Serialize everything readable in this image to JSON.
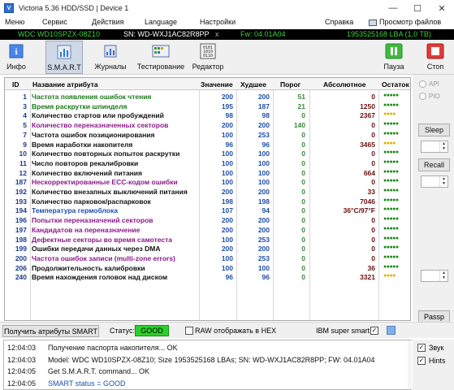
{
  "window": {
    "title": "Victoria 5.36 HDD/SSD | Device 1",
    "app_icon": "V"
  },
  "menu": {
    "items": [
      "Меню",
      "Сервис",
      "Действия",
      "Language",
      "Настройки",
      "Справка"
    ],
    "browser": "Просмотр файлов"
  },
  "device": {
    "model": "WDC WD10SPZX-08Z10",
    "sn": "SN: WD-WXJ1AC82R8PP",
    "close": "x",
    "fw": "Fw: 04.01A04",
    "capacity": "1953525168 LBA (1,0 TB)"
  },
  "toolbar": {
    "info": "Инфо",
    "smart": "S.M.A.R.T",
    "journals": "Журналы",
    "testing": "Тестирование",
    "editor": "Редактор",
    "pause": "Пауза",
    "stop": "Стоп"
  },
  "table": {
    "columns": {
      "id": "ID",
      "name": "Название атрибута",
      "value": "Значение",
      "worst": "Худшее",
      "threshold": "Порог",
      "raw": "Абсолютное",
      "status": "Остаток"
    },
    "rows": [
      {
        "id": "1",
        "name": "Частота появления ошибок чтения",
        "value": "200",
        "worst": "200",
        "threshold": "51",
        "raw": "0",
        "status": "●●●●●",
        "name_color": "#1a7a1a",
        "status_color": "#1a8a1a"
      },
      {
        "id": "3",
        "name": "Время раскрутки шпинделя",
        "value": "195",
        "worst": "187",
        "threshold": "21",
        "raw": "1250",
        "status": "●●●●●",
        "name_color": "#1a7a1a",
        "status_color": "#1a8a1a"
      },
      {
        "id": "4",
        "name": "Количество стартов или пробуждений",
        "value": "98",
        "worst": "98",
        "threshold": "0",
        "raw": "2367",
        "status": "●●●●",
        "name_color": "#111111",
        "status_color": "#e0b000"
      },
      {
        "id": "5",
        "name": "Количество переназначенных секторов",
        "value": "200",
        "worst": "200",
        "threshold": "140",
        "raw": "0",
        "status": "●●●●●",
        "name_color": "#8a1a8a",
        "status_color": "#1a8a1a"
      },
      {
        "id": "7",
        "name": "Частота ошибок позиционирования",
        "value": "100",
        "worst": "253",
        "threshold": "0",
        "raw": "0",
        "status": "●●●●●",
        "name_color": "#111111",
        "status_color": "#1a8a1a"
      },
      {
        "id": "9",
        "name": "Время наработки накопителя",
        "value": "96",
        "worst": "96",
        "threshold": "0",
        "raw": "3465",
        "status": "●●●●",
        "name_color": "#111111",
        "status_color": "#e0b000"
      },
      {
        "id": "10",
        "name": "Количество повторных попыток раскрутки",
        "value": "100",
        "worst": "100",
        "threshold": "0",
        "raw": "0",
        "status": "●●●●●",
        "name_color": "#111111",
        "status_color": "#1a8a1a"
      },
      {
        "id": "11",
        "name": "Число повторов рекалибровки",
        "value": "100",
        "worst": "100",
        "threshold": "0",
        "raw": "0",
        "status": "●●●●●",
        "name_color": "#111111",
        "status_color": "#1a8a1a"
      },
      {
        "id": "12",
        "name": "Количество включений питания",
        "value": "100",
        "worst": "100",
        "threshold": "0",
        "raw": "664",
        "status": "●●●●●",
        "name_color": "#111111",
        "status_color": "#1a8a1a"
      },
      {
        "id": "187",
        "name": "Нескорректированные ECC-кодом ошибки",
        "value": "100",
        "worst": "100",
        "threshold": "0",
        "raw": "0",
        "status": "●●●●●",
        "name_color": "#8a1a8a",
        "status_color": "#1a8a1a"
      },
      {
        "id": "192",
        "name": "Количество внезапных выключений питания",
        "value": "200",
        "worst": "200",
        "threshold": "0",
        "raw": "33",
        "status": "●●●●●",
        "name_color": "#111111",
        "status_color": "#1a8a1a"
      },
      {
        "id": "193",
        "name": "Количество парковок/распарковок",
        "value": "198",
        "worst": "198",
        "threshold": "0",
        "raw": "7046",
        "status": "●●●●●",
        "name_color": "#111111",
        "status_color": "#1a8a1a"
      },
      {
        "id": "194",
        "name": "Температура гермоблока",
        "value": "107",
        "worst": "94",
        "threshold": "0",
        "raw": "36°C/97°F",
        "status": "●●●●●",
        "name_color": "#1a4fb0",
        "status_color": "#1a8a1a"
      },
      {
        "id": "196",
        "name": "Попытки переназначений секторов",
        "value": "200",
        "worst": "200",
        "threshold": "0",
        "raw": "0",
        "status": "●●●●●",
        "name_color": "#8a1a8a",
        "status_color": "#1a8a1a"
      },
      {
        "id": "197",
        "name": "Кандидатов на переназначение",
        "value": "200",
        "worst": "200",
        "threshold": "0",
        "raw": "0",
        "status": "●●●●●",
        "name_color": "#8a1a8a",
        "status_color": "#1a8a1a"
      },
      {
        "id": "198",
        "name": "Дефектные секторы во время самотеста",
        "value": "100",
        "worst": "253",
        "threshold": "0",
        "raw": "0",
        "status": "●●●●●",
        "name_color": "#8a1a8a",
        "status_color": "#1a8a1a"
      },
      {
        "id": "199",
        "name": "Ошибки передачи данных через DMA",
        "value": "200",
        "worst": "200",
        "threshold": "0",
        "raw": "0",
        "status": "●●●●●",
        "name_color": "#111111",
        "status_color": "#1a8a1a"
      },
      {
        "id": "200",
        "name": "Частота ошибок записи (multi-zone errors)",
        "value": "100",
        "worst": "253",
        "threshold": "0",
        "raw": "0",
        "status": "●●●●●",
        "name_color": "#8a1a8a",
        "status_color": "#1a8a1a"
      },
      {
        "id": "206",
        "name": "Продолжительность калибровки",
        "value": "100",
        "worst": "100",
        "threshold": "0",
        "raw": "36",
        "status": "●●●●●",
        "name_color": "#111111",
        "status_color": "#1a8a1a"
      },
      {
        "id": "240",
        "name": "Время нахождения головок над диском",
        "value": "96",
        "worst": "96",
        "threshold": "0",
        "raw": "3321",
        "status": "●●●●",
        "name_color": "#111111",
        "status_color": "#e0b000"
      }
    ]
  },
  "side": {
    "api": "API",
    "pio": "PIO",
    "sleep": "Sleep",
    "recall": "Recall",
    "passp": "Passp"
  },
  "status": {
    "get_smart": "Получить атрибуты SMART",
    "label": "Статус:",
    "value": "GOOD",
    "raw_hex": "RAW отображать в HEX",
    "ibm": "IBM super smart:",
    "check": "✓"
  },
  "log": {
    "lines": [
      {
        "time": "12:04:03",
        "msg": "Получение паспорта накопителя... OK",
        "color": "#111111"
      },
      {
        "time": "12:04:03",
        "msg": "Model: WDC WD10SPZX-08Z10; Size 1953525168 LBAs; SN: WD-WXJ1AC82R8PP; FW: 04.01A04",
        "color": "#111111"
      },
      {
        "time": "12:04:05",
        "msg": "Get S.M.A.R.T. command... OK",
        "color": "#111111"
      },
      {
        "time": "12:04:05",
        "msg": "SMART status = GOOD",
        "color": "#1a4fb0"
      }
    ],
    "sound": "Звук",
    "hints": "Hints"
  }
}
